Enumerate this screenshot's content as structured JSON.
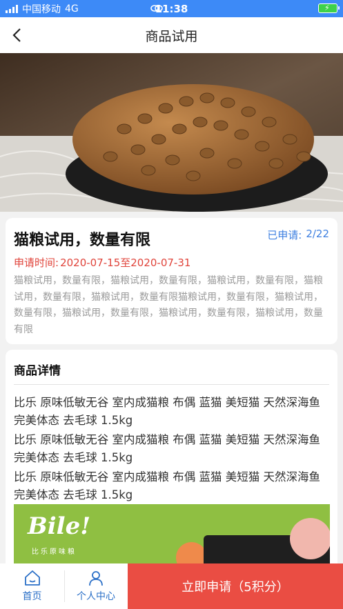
{
  "status_bar": {
    "carrier": "中国移动",
    "network": "4G",
    "time": "11:38"
  },
  "nav": {
    "title": "商品试用"
  },
  "trial": {
    "title": "猫粮试用，数量有限",
    "applied_label": "已申请:",
    "applied_count": "2/22",
    "period_label": "申请时间:",
    "period_value": "2020-07-15至2020-07-31",
    "description": "猫粮试用，数量有限，猫粮试用，数量有限，猫粮试用，数量有限，猫粮试用，数量有限，猫粮试用，数量有限猫粮试用，数量有限，猫粮试用，数量有限，猫粮试用，数量有限，猫粮试用，数量有限，猫粮试用，数量有限"
  },
  "detail": {
    "heading": "商品详情",
    "lines": [
      "比乐 原味低敏无谷 室内成猫粮 布偶 蓝猫 美短猫 天然深海鱼完美体态 去毛球 1.5kg",
      "比乐 原味低敏无谷 室内成猫粮 布偶 蓝猫 美短猫 天然深海鱼完美体态 去毛球 1.5kg",
      "比乐 原味低敏无谷 室内成猫粮 布偶 蓝猫 美短猫 天然深海鱼完美体态 去毛球 1.5kg"
    ],
    "banner_brand": "Bile!",
    "banner_sub": "比乐原味粮"
  },
  "tabbar": {
    "home": "首页",
    "user_center": "个人中心",
    "apply_button": "立即申请（5积分）"
  },
  "colors": {
    "status_bar": "#3d8af7",
    "accent_blue": "#3d7fe0",
    "accent_red": "#ea4d43",
    "period_red": "#e0433a",
    "tab_blue": "#2a6fc7"
  }
}
